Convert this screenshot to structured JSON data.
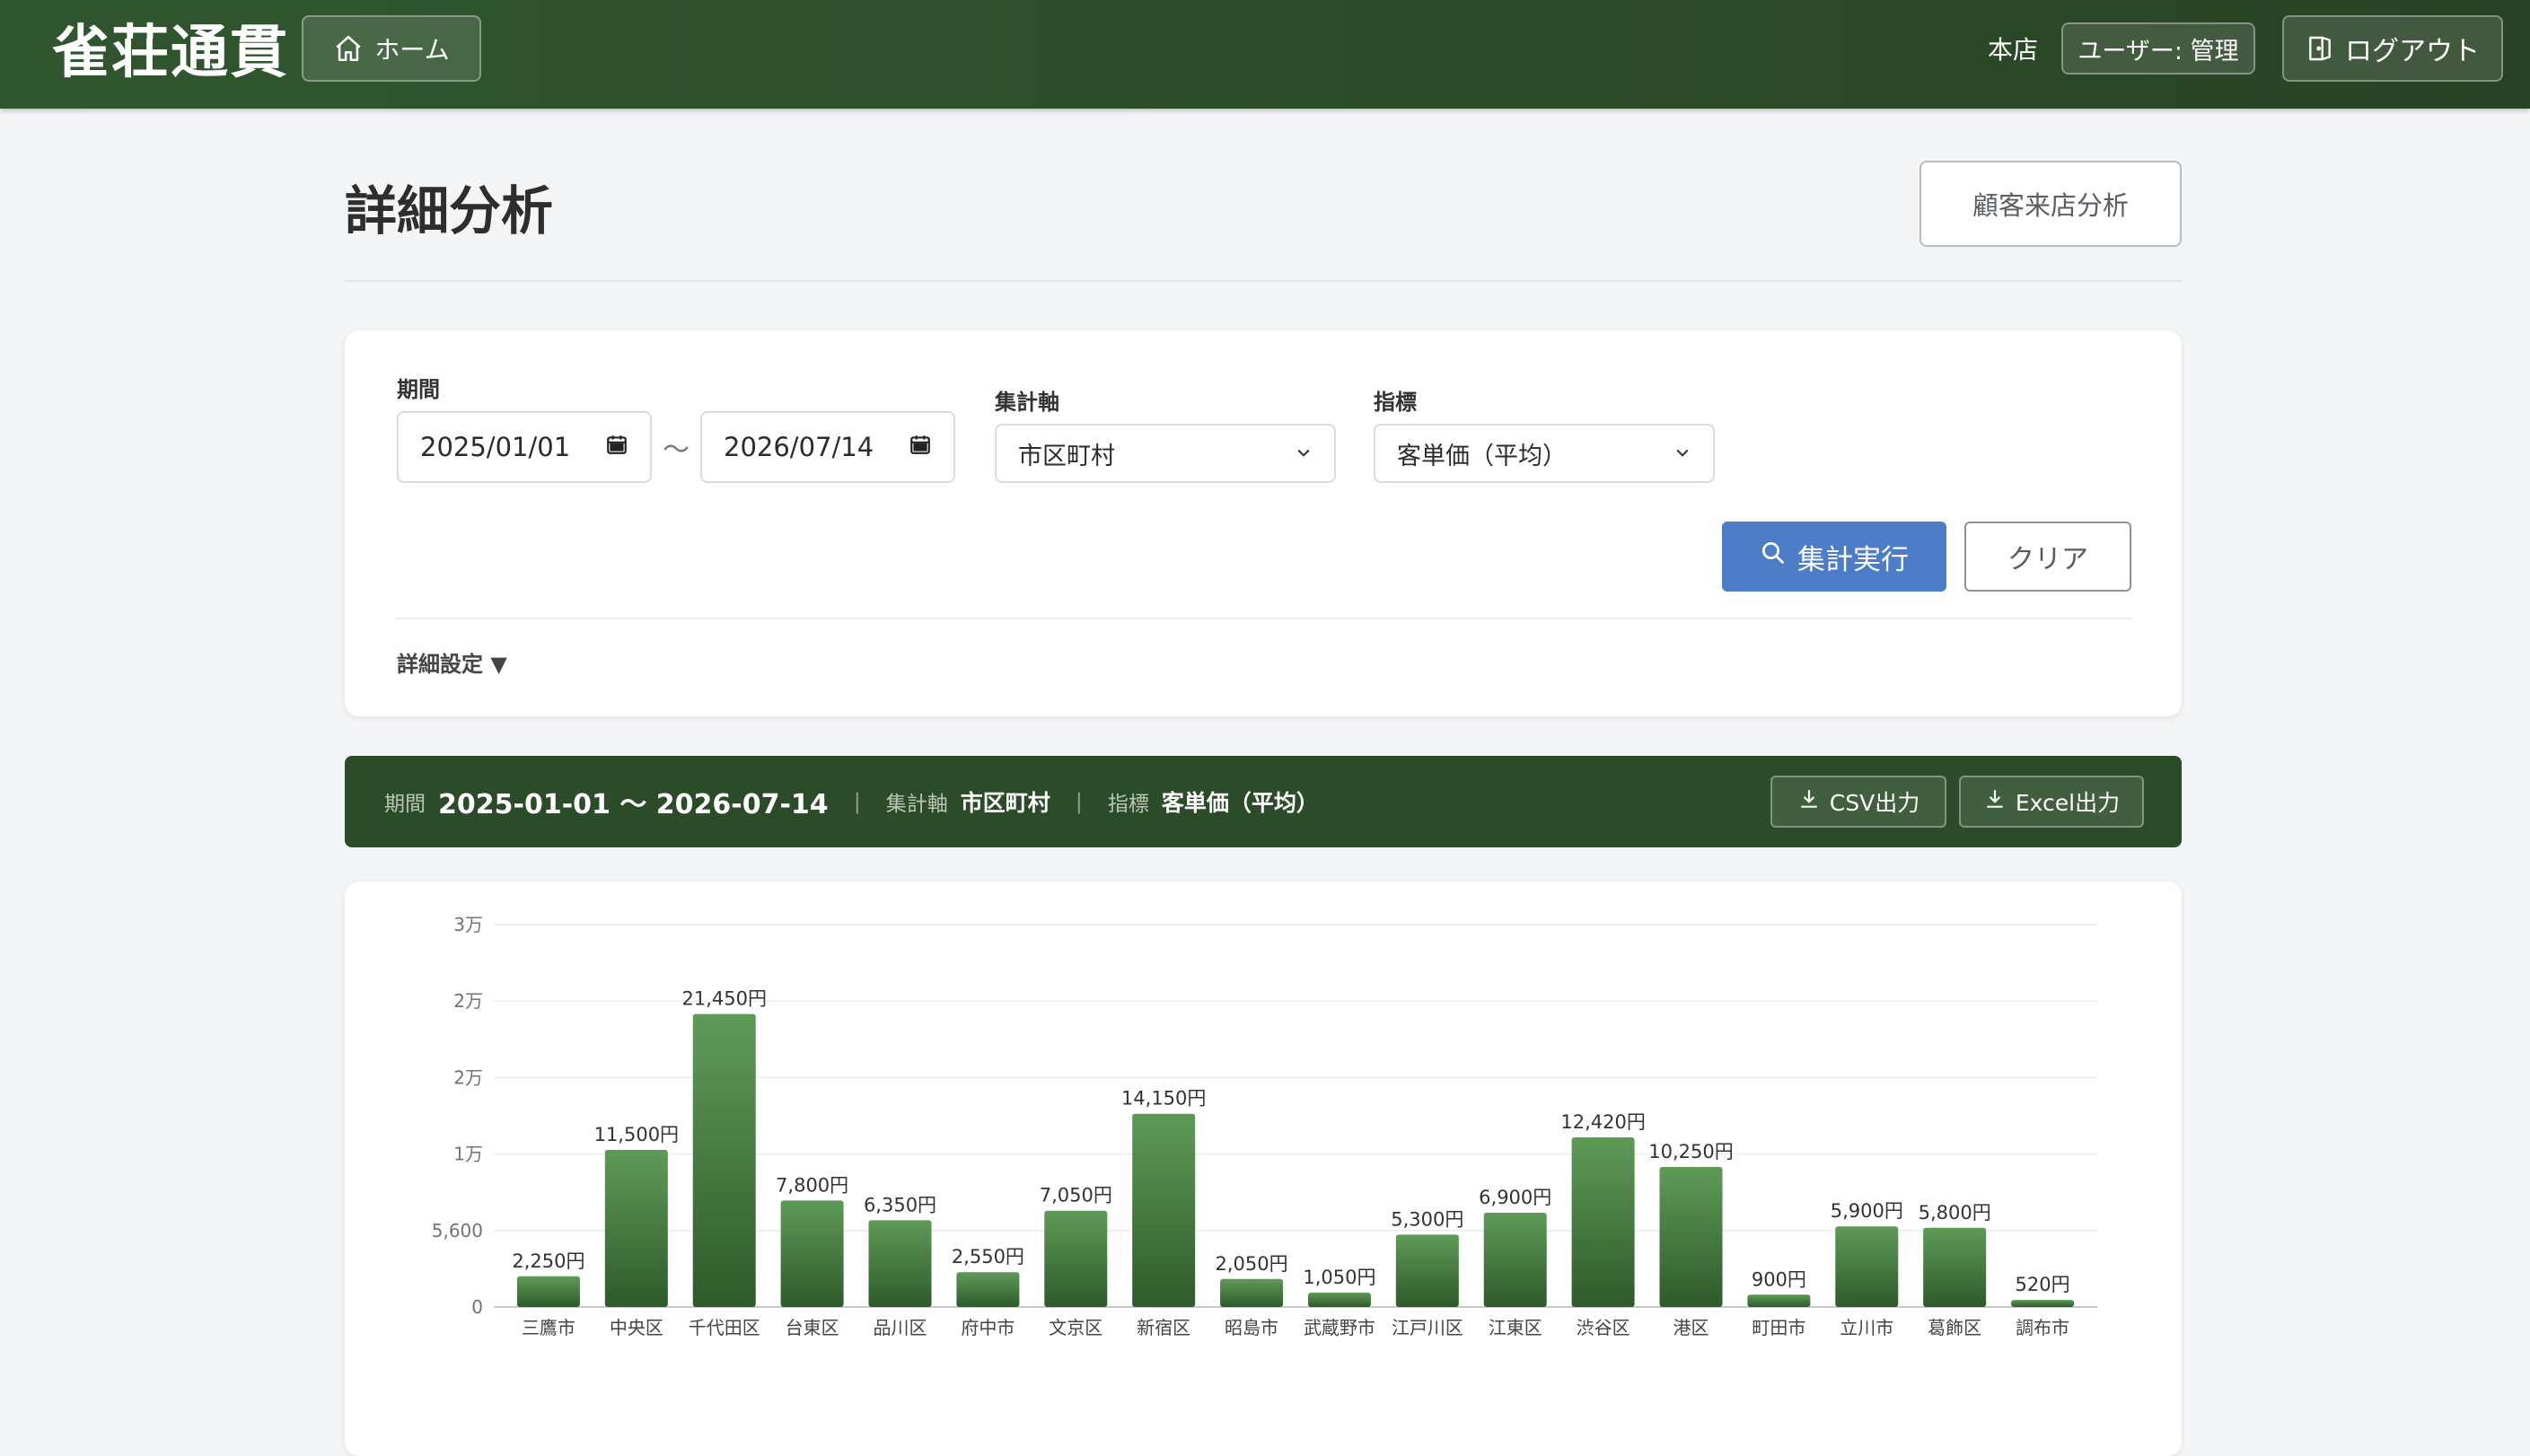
{
  "header": {
    "logo": "雀荘通貫",
    "home_label": "ホーム",
    "store": "本店",
    "user": "ユーザー: 管理",
    "logout_label": "ログアウト"
  },
  "page": {
    "title": "詳細分析",
    "visit_analysis_label": "顧客来店分析"
  },
  "filters": {
    "period_label": "期間",
    "date_from": "2025/01/01",
    "tilde": "〜",
    "date_to": "2026/07/14",
    "axis_label": "集計軸",
    "axis_value": "市区町村",
    "metric_label": "指標",
    "metric_value": "客単価（平均）",
    "run_label": "集計実行",
    "clear_label": "クリア",
    "detail_label": "詳細設定 ▼"
  },
  "summary": {
    "period_key": "期間",
    "period_value": "2025-01-01 〜 2026-07-14",
    "sep": "|",
    "axis_key": "集計軸",
    "axis_value": "市区町村",
    "metric_key": "指標",
    "metric_value": "客単価（平均）",
    "csv_label": "CSV出力",
    "excel_label": "Excel出力"
  },
  "colors": {
    "header": "#2d4d2a",
    "accent_blue": "#4c7dc6",
    "bar_top": "#5f9a58",
    "bar_bottom": "#2f5a2b"
  },
  "chart_data": {
    "type": "bar",
    "categories": [
      "三鷹市",
      "中央区",
      "千代田区",
      "台東区",
      "品川区",
      "府中市",
      "文京区",
      "新宿区",
      "昭島市",
      "武蔵野市",
      "江戸川区",
      "江東区",
      "渋谷区",
      "港区",
      "町田市",
      "立川市",
      "葛飾区",
      "調布市"
    ],
    "values": [
      2250,
      11500,
      21450,
      7800,
      6350,
      2550,
      7050,
      14150,
      2050,
      1050,
      5300,
      6900,
      12420,
      10250,
      900,
      5900,
      5800,
      520
    ],
    "value_labels": [
      "2,250円",
      "11,500円",
      "21,450円",
      "7,800円",
      "6,350円",
      "2,550円",
      "7,050円",
      "14,150円",
      "2,050円",
      "1,050円",
      "5,300円",
      "6,900円",
      "12,420円",
      "10,250円",
      "900円",
      "5,900円",
      "5,800円",
      "520円"
    ],
    "y_ticks": [
      0,
      5600,
      11200,
      16800,
      22400,
      28000
    ],
    "y_tick_labels": [
      "0",
      "5,600",
      "1万",
      "2万",
      "2万",
      "3万"
    ],
    "ylim": [
      0,
      28000
    ],
    "grid": true,
    "legend": "none"
  }
}
